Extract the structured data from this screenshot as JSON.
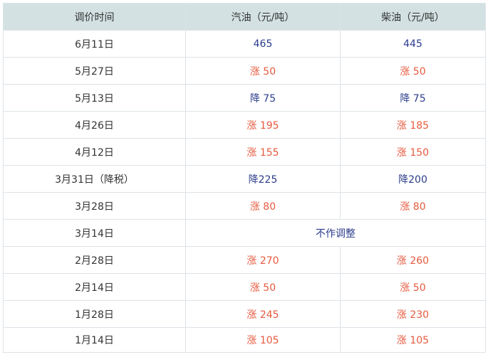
{
  "colors": {
    "header_bg": "#d3e1e2",
    "rise": "#e65a3e",
    "fall": "#2b3c8c",
    "text": "#333333"
  },
  "headers": [
    "调价时间",
    "汽油（元/吨）",
    "柴油（元/吨）"
  ],
  "rows": [
    {
      "date": "6月11日",
      "gasoline": "465",
      "diesel": "445"
    },
    {
      "date": "5月27日",
      "gasoline": "涨 50",
      "diesel": "涨 50"
    },
    {
      "date": "5月13日",
      "gasoline": "降 75",
      "diesel": "降 75"
    },
    {
      "date": "4月26日",
      "gasoline": "涨 195",
      "diesel": "涨 185"
    },
    {
      "date": "4月12日",
      "gasoline": "涨 155",
      "diesel": "涨 150"
    },
    {
      "date": "3月31日（降税）",
      "gasoline": "降225",
      "diesel": "降200"
    },
    {
      "date": "3月28日",
      "gasoline": "涨 80",
      "diesel": "涨 80"
    },
    {
      "date": "3月14日",
      "merged": "不作调整"
    },
    {
      "date": "2月28日",
      "gasoline": "涨 270",
      "diesel": "涨 260"
    },
    {
      "date": "2月14日",
      "gasoline": "涨 50",
      "diesel": "涨 50"
    },
    {
      "date": "1月28日",
      "gasoline": "涨 245",
      "diesel": "涨 230"
    },
    {
      "date": "1月14日",
      "gasoline": "涨 105",
      "diesel": "涨 105"
    }
  ]
}
